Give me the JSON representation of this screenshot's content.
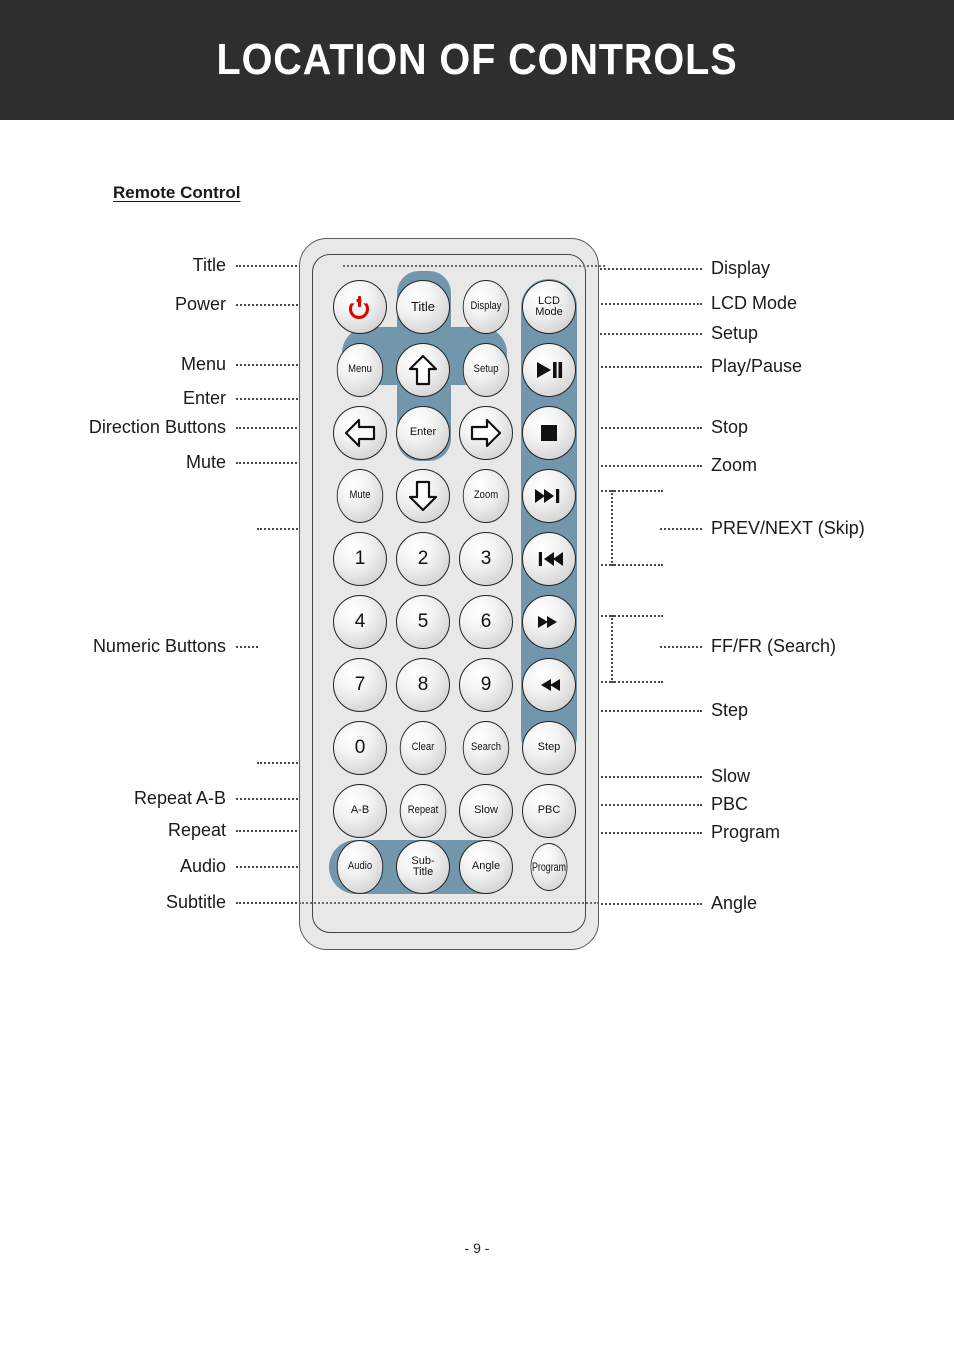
{
  "header": {
    "title": "LOCATION OF CONTROLS"
  },
  "section": {
    "label": "Remote Control"
  },
  "footer": {
    "page_number": "- 9 -"
  },
  "colors": {
    "header_bg": "#2e2e2e",
    "accent_blue_gray": "#7296ab",
    "remote_body": "#e8e8e8",
    "power_red": "#e10000",
    "text": "#1a1a1a"
  },
  "callouts_left": [
    {
      "label": "Title"
    },
    {
      "label": "Power"
    },
    {
      "label": "Menu"
    },
    {
      "label": "Enter"
    },
    {
      "label": "Direction Buttons"
    },
    {
      "label": "Mute"
    },
    {
      "label": "Numeric Buttons"
    },
    {
      "label": "Repeat A-B"
    },
    {
      "label": "Repeat"
    },
    {
      "label": "Audio"
    },
    {
      "label": "Subtitle"
    }
  ],
  "callouts_right": [
    {
      "label": "Display"
    },
    {
      "label": "LCD Mode"
    },
    {
      "label": "Setup"
    },
    {
      "label": "Play/Pause"
    },
    {
      "label": "Stop"
    },
    {
      "label": "Zoom"
    },
    {
      "label": "PREV/NEXT (Skip)"
    },
    {
      "label": "FF/FR (Search)"
    },
    {
      "label": "Step"
    },
    {
      "label": "Slow"
    },
    {
      "label": "PBC"
    },
    {
      "label": "Program"
    },
    {
      "label": "Angle"
    }
  ],
  "remote_buttons": {
    "power": {
      "label": "",
      "icon": "power-icon"
    },
    "title": {
      "label": "Title"
    },
    "display": {
      "label": "Display"
    },
    "lcd_mode": {
      "label_line1": "LCD",
      "label_line2": "Mode"
    },
    "menu": {
      "label": "Menu"
    },
    "up": {
      "label": "",
      "icon": "arrow-up-icon"
    },
    "setup": {
      "label": "Setup"
    },
    "play_pause": {
      "label": "",
      "icon": "play-pause-icon"
    },
    "left": {
      "label": "",
      "icon": "arrow-left-icon"
    },
    "enter": {
      "label": "Enter"
    },
    "right": {
      "label": "",
      "icon": "arrow-right-icon"
    },
    "stop": {
      "label": "",
      "icon": "stop-icon"
    },
    "mute": {
      "label": "Mute"
    },
    "down": {
      "label": "",
      "icon": "arrow-down-icon"
    },
    "zoom": {
      "label": "Zoom"
    },
    "next": {
      "label": "",
      "icon": "skip-next-icon"
    },
    "prev": {
      "label": "",
      "icon": "skip-prev-icon"
    },
    "ff": {
      "label": "",
      "icon": "fast-forward-icon"
    },
    "fr": {
      "label": "",
      "icon": "fast-rewind-icon"
    },
    "step": {
      "label": "Step"
    },
    "num1": {
      "label": "1"
    },
    "num2": {
      "label": "2"
    },
    "num3": {
      "label": "3"
    },
    "num4": {
      "label": "4"
    },
    "num5": {
      "label": "5"
    },
    "num6": {
      "label": "6"
    },
    "num7": {
      "label": "7"
    },
    "num8": {
      "label": "8"
    },
    "num9": {
      "label": "9"
    },
    "num0": {
      "label": "0"
    },
    "clear": {
      "label": "Clear"
    },
    "search": {
      "label": "Search"
    },
    "ab": {
      "label": "A-B"
    },
    "repeat": {
      "label": "Repeat"
    },
    "slow": {
      "label": "Slow"
    },
    "pbc": {
      "label": "PBC"
    },
    "audio": {
      "label": "Audio"
    },
    "subtitle": {
      "label_line1": "Sub-",
      "label_line2": "Title"
    },
    "angle": {
      "label": "Angle"
    },
    "program": {
      "label": "Program"
    }
  }
}
